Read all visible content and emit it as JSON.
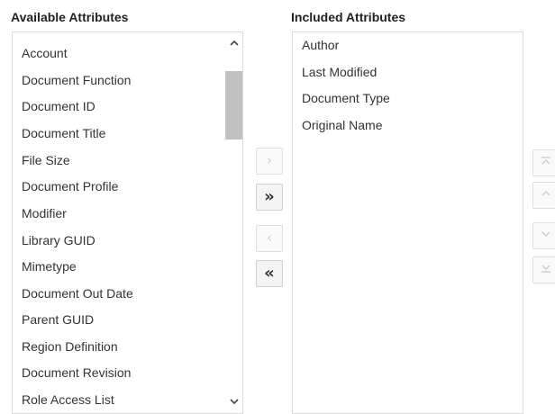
{
  "available": {
    "header": "Available Attributes",
    "items": [
      "Account",
      "Document Function",
      "Document ID",
      "Document Title",
      "File Size",
      "Document Profile",
      "Modifier",
      "Library GUID",
      "Mimetype",
      "Document Out Date",
      "Parent GUID",
      "Region Definition",
      "Document Revision",
      "Role Access List"
    ],
    "scroll_up_icon": "chevron-up-icon",
    "scroll_down_icon": "chevron-down-icon"
  },
  "included": {
    "header": "Included Attributes",
    "items": [
      "Author",
      "Last Modified",
      "Document Type",
      "Original Name"
    ]
  },
  "transfer_buttons": {
    "move_right": "›",
    "move_all_right": "»",
    "move_left": "‹",
    "move_all_left": "«"
  },
  "reorder_buttons": {
    "move_top_icon": "move-to-top-icon",
    "move_up_icon": "move-up-icon",
    "move_down_icon": "move-down-icon",
    "move_bottom_icon": "move-to-bottom-icon"
  },
  "colors": {
    "border": "#dcdcdc",
    "scroll_thumb": "#c1c1c1",
    "disabled": "#cccccc",
    "text": "#333333"
  }
}
